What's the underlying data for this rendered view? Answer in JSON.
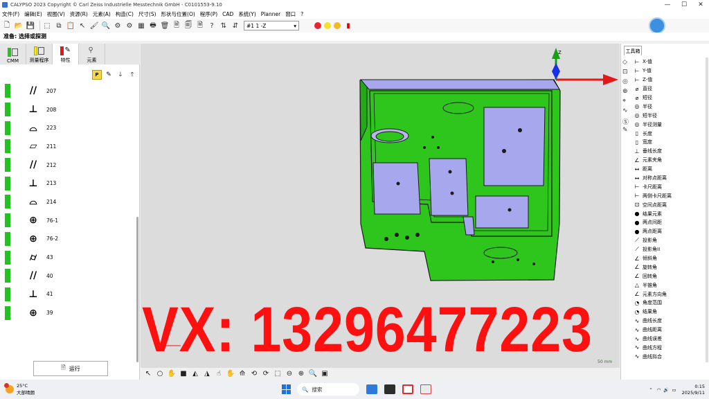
{
  "window": {
    "title": "CALYPSO 2023 Copyright © Carl Zeiss Industrielle Messtechnik GmbH - C0101553-9.10",
    "controls": [
      "—",
      "☐",
      "✕"
    ]
  },
  "menu": [
    "文件(F)",
    "编辑(E)",
    "视图(V)",
    "资源(R)",
    "元素(A)",
    "构造(C)",
    "尺寸(S)",
    "形状与位置(O)",
    "程序(P)",
    "CAD",
    "系统(Y)",
    "Planner",
    "窗口",
    "?"
  ],
  "toolbar": {
    "combo_value": "#1    1 -Z",
    "status_dot_colors": [
      "#e8262f",
      "#f5e12a",
      "#f6b62a"
    ]
  },
  "status_line": "准备: 选择或探测",
  "left_panel": {
    "tabs": [
      {
        "label": "CMM"
      },
      {
        "label": "测量程序"
      },
      {
        "label": "特性"
      },
      {
        "label": "元素"
      }
    ],
    "active_tab": "特性",
    "features": [
      {
        "symbol": "//",
        "label": "207"
      },
      {
        "symbol": "⊥",
        "label": "208"
      },
      {
        "symbol": "⌓",
        "label": "223"
      },
      {
        "symbol": "▱",
        "label": "211"
      },
      {
        "symbol": "//",
        "label": "212"
      },
      {
        "symbol": "⊥",
        "label": "213"
      },
      {
        "symbol": "⌓",
        "label": "214"
      },
      {
        "symbol": "⊕",
        "label": "76-1"
      },
      {
        "symbol": "⊕",
        "label": "76-2"
      },
      {
        "symbol": "⌭",
        "label": "43"
      },
      {
        "symbol": "//",
        "label": "40"
      },
      {
        "symbol": "⊥",
        "label": "41"
      },
      {
        "symbol": "⊕",
        "label": "39"
      }
    ],
    "run_button": "运行"
  },
  "viewport": {
    "axis_label": "Z",
    "scale_label": "50 mm",
    "watermark": "VX: 13296477223",
    "part_colors": {
      "body": "#2ec51c",
      "top": "#a7a7ee",
      "edge": "#1a1a1a"
    }
  },
  "right_panel": {
    "tab": "工具箱",
    "items": [
      "X-值",
      "Y-值",
      "Z-值",
      "直径",
      "短径",
      "半径",
      "短半径",
      "半径测量",
      "长度",
      "宽度",
      "垂线长度",
      "元素夹角",
      "距离",
      "对称点距离",
      "卡尺距离",
      "两侧卡尺距离",
      "空间点距离",
      "结果元素",
      "两点间距",
      "两点距离",
      "投影角",
      "投影角II",
      "倾斜角",
      "旋转角",
      "回转角",
      "半锥角",
      "元素方向角",
      "角度范围",
      "结果角",
      "曲线长度",
      "曲线距离",
      "曲线误差",
      "曲线方程",
      "曲线拟合"
    ]
  },
  "taskbar": {
    "weather_temp": "25°C",
    "weather_text": "大部晴朗",
    "search_placeholder": "搜索",
    "time": "0:15",
    "date": "2025/9/11"
  }
}
